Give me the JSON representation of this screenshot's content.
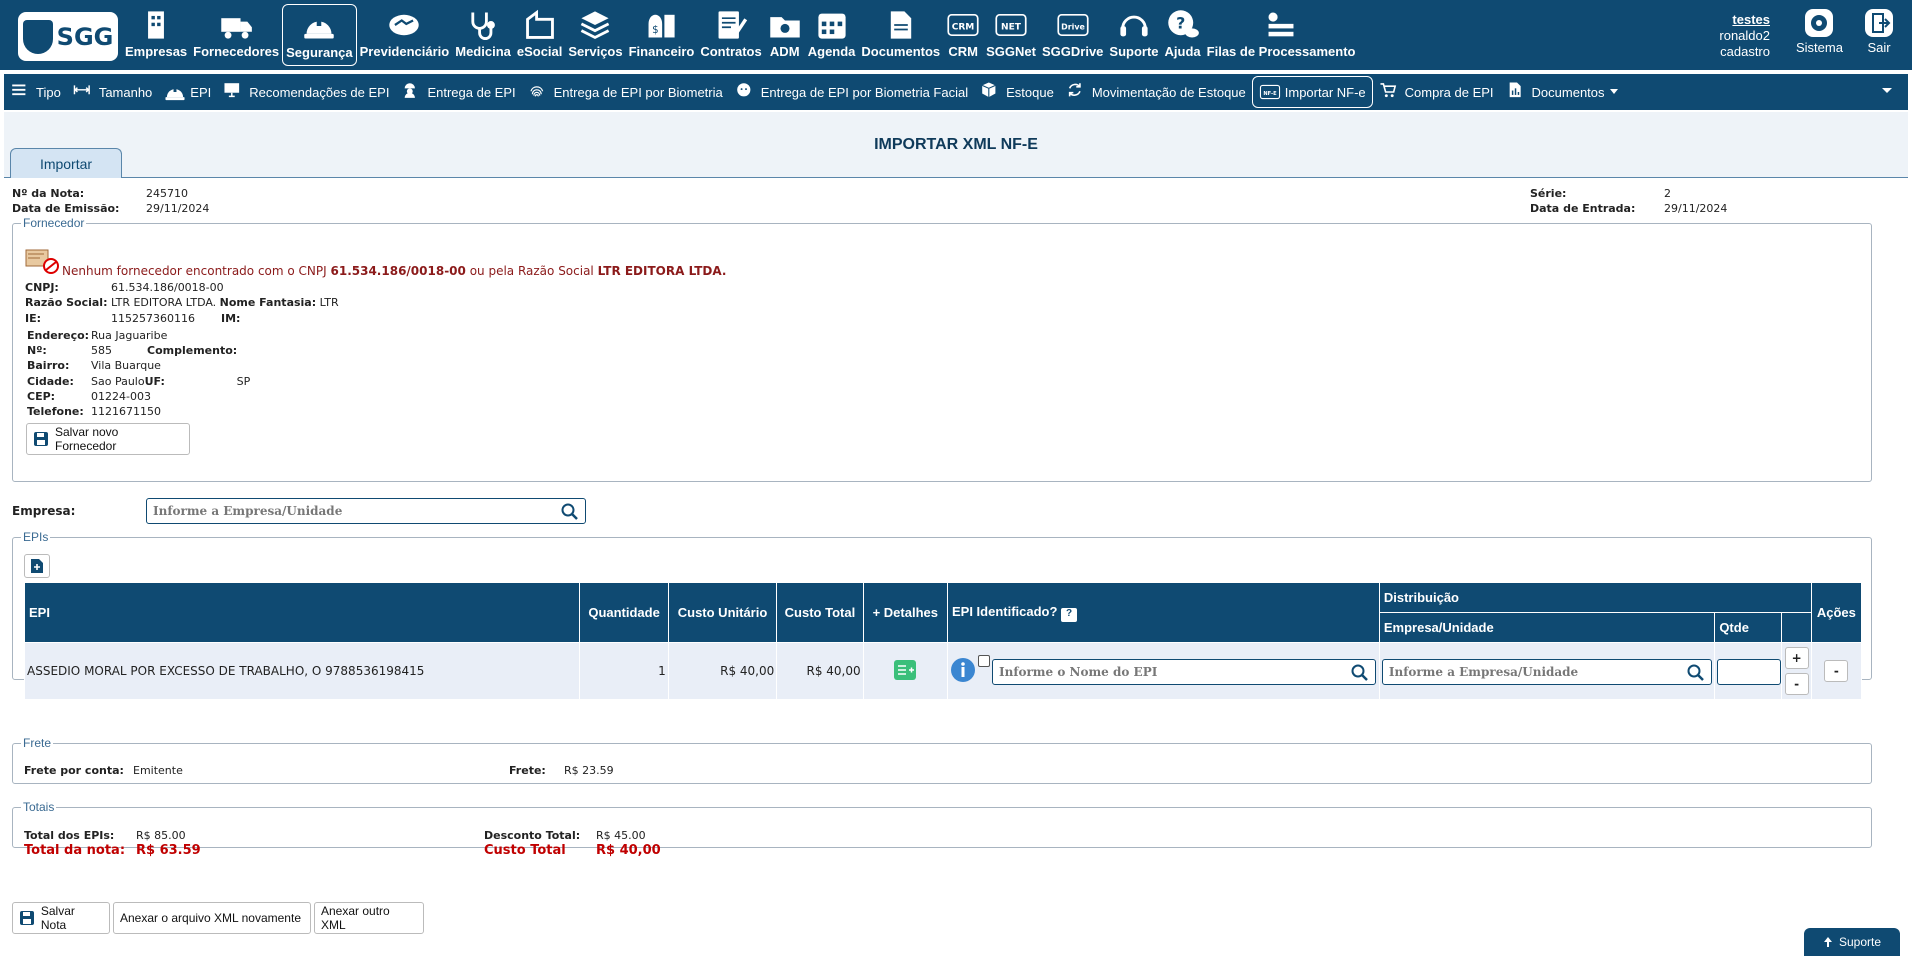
{
  "brand": {
    "logo_text": "SGG"
  },
  "modules": [
    {
      "label": "Empresas",
      "icon": "building-icon"
    },
    {
      "label": "Fornecedores",
      "icon": "truck-icon"
    },
    {
      "label": "Segurança",
      "icon": "hardhat-icon",
      "active": true
    },
    {
      "label": "Previdenciário",
      "icon": "handshake-icon"
    },
    {
      "label": "Medicina",
      "icon": "stethoscope-icon"
    },
    {
      "label": "eSocial",
      "icon": "esocial-icon"
    },
    {
      "label": "Serviços",
      "icon": "layers-icon"
    },
    {
      "label": "Financeiro",
      "icon": "money-icon"
    },
    {
      "label": "Contratos",
      "icon": "contract-icon"
    },
    {
      "label": "ADM",
      "icon": "folder-icon"
    },
    {
      "label": "Agenda",
      "icon": "calendar-icon"
    },
    {
      "label": "Documentos",
      "icon": "document-icon"
    },
    {
      "label": "CRM",
      "icon": "crm-icon",
      "icon_text": "CRM"
    },
    {
      "label": "SGGNet",
      "icon": "net-icon",
      "icon_text": "NET"
    },
    {
      "label": "SGGDrive",
      "icon": "drive-icon",
      "icon_text": "Drive"
    },
    {
      "label": "Suporte",
      "icon": "headset-icon"
    },
    {
      "label": "Ajuda",
      "icon": "help-chat-icon"
    },
    {
      "label": "Filas de Processamento",
      "icon": "queue-icon",
      "bold": true
    }
  ],
  "user": {
    "link": "testes",
    "name": "ronaldo2",
    "role": "cadastro",
    "system_label": "Sistema",
    "exit_label": "Sair"
  },
  "subnav": [
    {
      "label": "Tipo",
      "icon": "list-icon"
    },
    {
      "label": "Tamanho",
      "icon": "resize-icon"
    },
    {
      "label": "EPI",
      "icon": "hardhat-icon"
    },
    {
      "label": "Recomendações de EPI",
      "icon": "presentation-icon"
    },
    {
      "label": "Entrega de EPI",
      "icon": "worker-icon"
    },
    {
      "label": "Entrega de EPI por Biometria",
      "icon": "fingerprint-icon"
    },
    {
      "label": "Entrega de EPI por Biometria Facial",
      "icon": "face-icon"
    },
    {
      "label": "Estoque",
      "icon": "box-icon"
    },
    {
      "label": "Movimentação de Estoque",
      "icon": "refresh-icon"
    },
    {
      "label": "Importar NF-e",
      "icon": "nfe-icon",
      "icon_text": "NF-E",
      "active": true
    },
    {
      "label": "Compra de EPI",
      "icon": "cart-icon"
    },
    {
      "label": "Documentos",
      "icon": "report-icon",
      "dropdown": true
    }
  ],
  "page": {
    "title": "IMPORTAR XML NF-E",
    "tab": "Importar"
  },
  "note": {
    "numero_label": "Nº da Nota:",
    "numero": "245710",
    "emissao_label": "Data de Emissão:",
    "emissao": "29/11/2024",
    "serie_label": "Série:",
    "serie": "2",
    "entrada_label": "Data de Entrada:",
    "entrada": "29/11/2024"
  },
  "fornecedor": {
    "legend": "Fornecedor",
    "warning_prefix": "Nenhum fornecedor encontrado com o CNPJ ",
    "warning_cnpj": "61.534.186/0018-00",
    "warning_mid": " ou pela Razão Social ",
    "warning_razao": "LTR EDITORA LTDA.",
    "cnpj_label": "CNPJ:",
    "cnpj": "61.534.186/0018-00",
    "razao_label": "Razão Social:",
    "razao": "LTR EDITORA LTDA.",
    "fantasia_label": "Nome Fantasia:",
    "fantasia": "LTR",
    "ie_label": "IE:",
    "ie": "115257360116",
    "im_label": "IM:",
    "im": "",
    "endereco_label": "Endereço:",
    "endereco": "Rua Jaguaribe",
    "numero_label": "Nº:",
    "numero": "585",
    "complemento_label": "Complemento:",
    "complemento": "",
    "bairro_label": "Bairro:",
    "bairro": "Vila Buarque",
    "cidade_label": "Cidade:",
    "cidade": "Sao Paulo",
    "uf_label": "UF:",
    "uf": "SP",
    "cep_label": "CEP:",
    "cep": "01224-003",
    "telefone_label": "Telefone:",
    "telefone": "1121671150",
    "save_button": "Salvar novo Fornecedor"
  },
  "empresa": {
    "label": "Empresa:",
    "placeholder": "Informe a Empresa/Unidade"
  },
  "epis": {
    "legend": "EPIs",
    "headers": {
      "epi": "EPI",
      "quantidade": "Quantidade",
      "custo_unit": "Custo Unitário",
      "custo_total": "Custo Total",
      "detalhes": "+ Detalhes",
      "identificado": "EPI Identificado?",
      "distribuicao": "Distribuição",
      "empresa_unidade": "Empresa/Unidade",
      "qtde": "Qtde",
      "acoes": "Ações"
    },
    "row": {
      "epi": "ASSEDIO MORAL POR EXCESSO DE TRABALHO, O 9788536198415",
      "quantidade": "1",
      "custo_unit": "R$ 40,00",
      "custo_total": "R$ 40,00",
      "epi_placeholder": "Informe o Nome do EPI",
      "empresa_placeholder": "Informe a Empresa/Unidade",
      "plus": "+",
      "minus": "-",
      "remove": "-"
    }
  },
  "frete": {
    "legend": "Frete",
    "conta_label": "Frete por conta:",
    "conta": "Emitente",
    "frete_label": "Frete:",
    "frete": "R$ 23.59"
  },
  "totais": {
    "legend": "Totais",
    "total_epis_label": "Total dos EPIs:",
    "total_epis": "R$ 85.00",
    "desconto_label": "Desconto Total:",
    "desconto": "R$ 45.00",
    "total_nota_label": "Total da nota:",
    "total_nota": "R$ 63.59",
    "custo_total_label": "Custo Total",
    "custo_total": "R$ 40,00"
  },
  "actions": {
    "save": "Salvar Nota",
    "reattach": "Anexar o arquivo XML novamente",
    "other": "Anexar outro XML"
  },
  "support_button": "Suporte",
  "colors": {
    "primary": "#0f4a72",
    "warning": "#8b1a1a",
    "alert": "#e00000",
    "success": "#3bbf7a"
  }
}
